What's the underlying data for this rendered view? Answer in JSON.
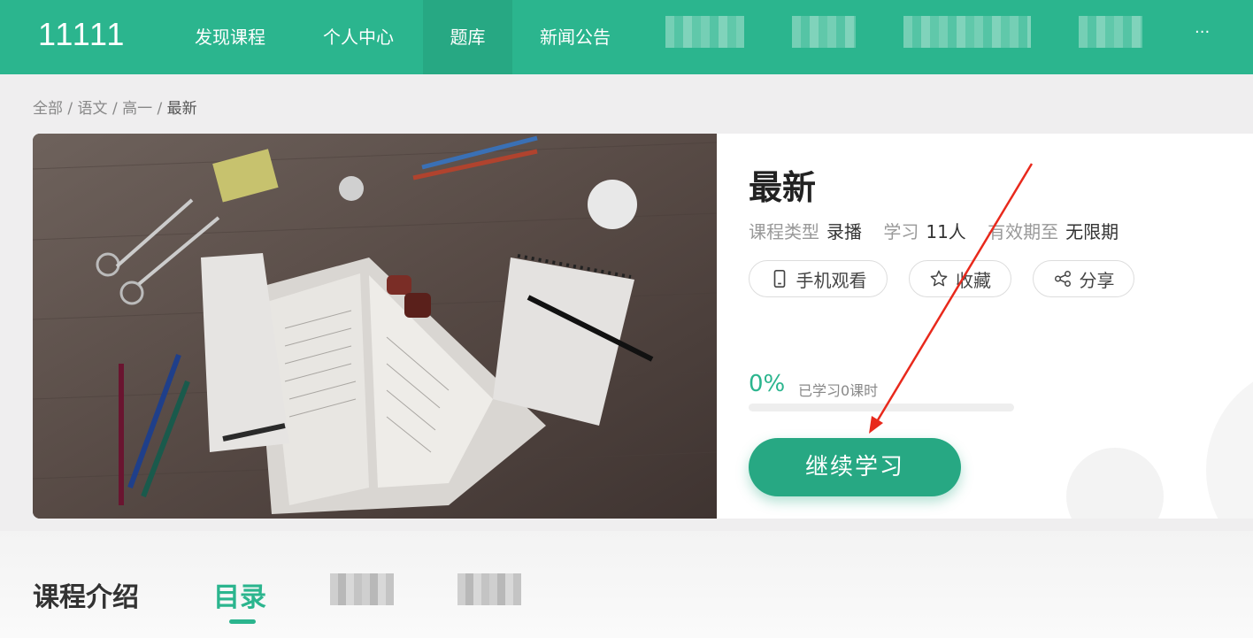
{
  "header": {
    "logo": "11111",
    "nav": [
      {
        "label": "发现课程"
      },
      {
        "label": "个人中心"
      },
      {
        "label": "题库",
        "active": true
      },
      {
        "label": "新闻公告"
      }
    ],
    "more": "···"
  },
  "breadcrumb": {
    "items": [
      "全部",
      "语文",
      "高一"
    ],
    "current": "最新",
    "sep": "/"
  },
  "course": {
    "title": "最新",
    "type_label": "课程类型",
    "type_value": "录播",
    "learners_label": "学习",
    "learners_value": "11人",
    "validity_label": "有效期至",
    "validity_value": "无限期",
    "actions": {
      "mobile": "手机观看",
      "favorite": "收藏",
      "share": "分享"
    },
    "progress": {
      "percent_text": "0%",
      "percent": 0,
      "learned_text": "已学习0课时"
    },
    "cta": "继续学习"
  },
  "tabs": [
    {
      "label": "课程介绍"
    },
    {
      "label": "目录",
      "active": true
    }
  ],
  "colors": {
    "brand": "#2bb58e",
    "annotation_arrow": "#e8291c"
  }
}
